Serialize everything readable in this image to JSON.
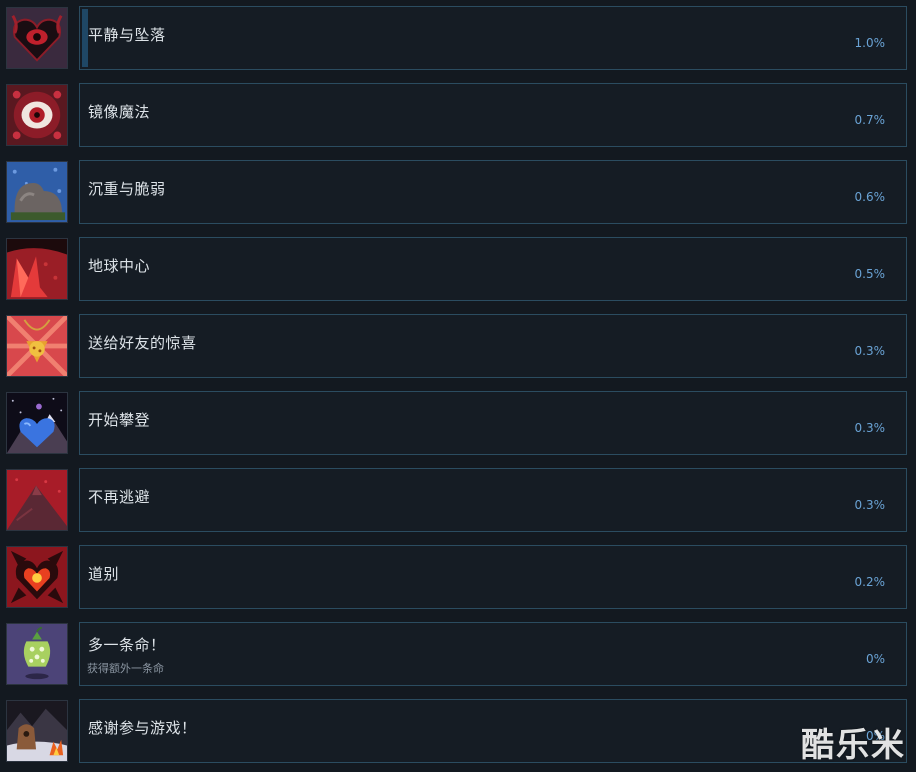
{
  "achievements": [
    {
      "title": "平静与坠落",
      "description": "",
      "percent": "1.0%",
      "progress": 0.01,
      "icon": "dark-heart-eye-icon"
    },
    {
      "title": "镜像魔法",
      "description": "",
      "percent": "0.7%",
      "progress": 0.007,
      "icon": "red-eye-icon"
    },
    {
      "title": "沉重与脆弱",
      "description": "",
      "percent": "0.6%",
      "progress": 0.006,
      "icon": "stone-heart-icon"
    },
    {
      "title": "地球中心",
      "description": "",
      "percent": "0.5%",
      "progress": 0.005,
      "icon": "red-crystal-icon"
    },
    {
      "title": "送给好友的惊喜",
      "description": "",
      "percent": "0.3%",
      "progress": 0.003,
      "icon": "strawberry-pendant-icon"
    },
    {
      "title": "开始攀登",
      "description": "",
      "percent": "0.3%",
      "progress": 0.003,
      "icon": "blue-heart-mountain-icon"
    },
    {
      "title": "不再逃避",
      "description": "",
      "percent": "0.3%",
      "progress": 0.003,
      "icon": "red-mountain-icon"
    },
    {
      "title": "道别",
      "description": "",
      "percent": "0.2%",
      "progress": 0.002,
      "icon": "spiked-red-heart-icon"
    },
    {
      "title": "多一条命！",
      "description": "获得额外一条命",
      "percent": "0%",
      "progress": 0,
      "icon": "winged-berry-icon"
    },
    {
      "title": "感谢参与游戏！",
      "description": "",
      "percent": "0%",
      "progress": 0,
      "icon": "campfire-icon"
    }
  ],
  "watermark": "酷乐米"
}
